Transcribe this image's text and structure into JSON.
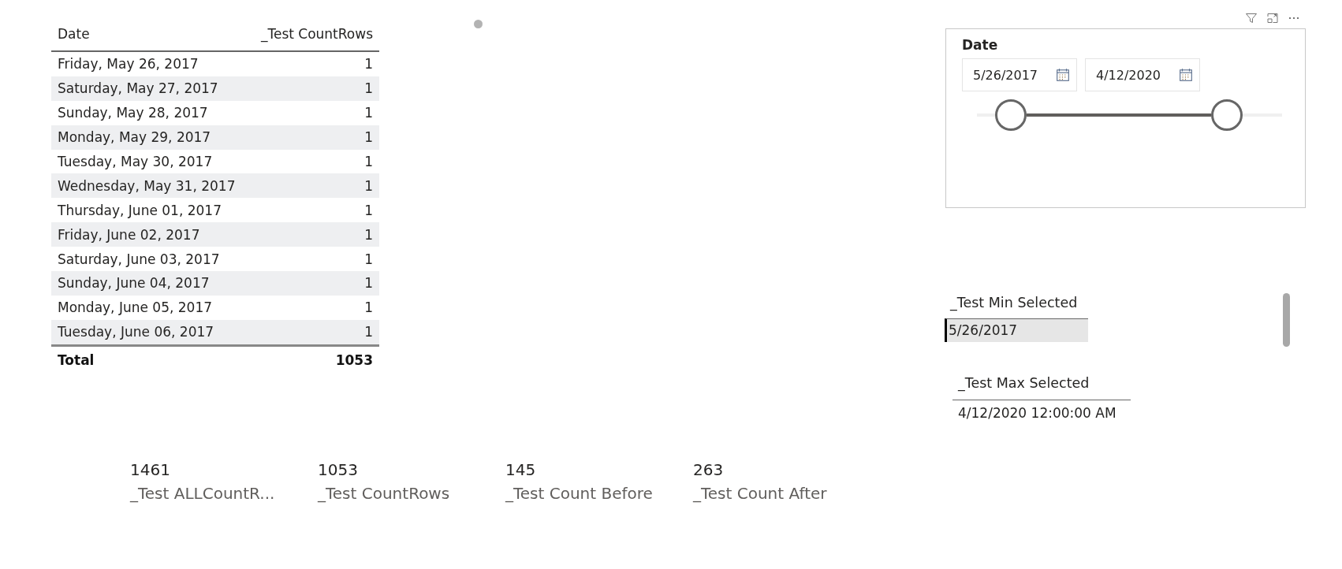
{
  "table": {
    "columns": [
      "Date",
      "_Test CountRows"
    ],
    "rows": [
      {
        "date": "Friday, May 26, 2017",
        "count": "1"
      },
      {
        "date": "Saturday, May 27, 2017",
        "count": "1"
      },
      {
        "date": "Sunday, May 28, 2017",
        "count": "1"
      },
      {
        "date": "Monday, May 29, 2017",
        "count": "1"
      },
      {
        "date": "Tuesday, May 30, 2017",
        "count": "1"
      },
      {
        "date": "Wednesday, May 31, 2017",
        "count": "1"
      },
      {
        "date": "Thursday, June 01, 2017",
        "count": "1"
      },
      {
        "date": "Friday, June 02, 2017",
        "count": "1"
      },
      {
        "date": "Saturday, June 03, 2017",
        "count": "1"
      },
      {
        "date": "Sunday, June 04, 2017",
        "count": "1"
      },
      {
        "date": "Monday, June 05, 2017",
        "count": "1"
      },
      {
        "date": "Tuesday, June 06, 2017",
        "count": "1"
      }
    ],
    "total": {
      "label": "Total",
      "value": "1053"
    }
  },
  "slicer": {
    "title": "Date",
    "start_input": {
      "value": "5/26/2017"
    },
    "end_input": {
      "value": "4/12/2020"
    },
    "handles": [
      {
        "level": 0.11
      },
      {
        "level": 0.82
      }
    ]
  },
  "min_selected": {
    "label": "_Test Min Selected",
    "value": "5/26/2017"
  },
  "max_selected": {
    "label": "_Test Max Selected",
    "value": "4/12/2020 12:00:00 AM"
  },
  "cards": [
    {
      "value": "1461",
      "label": "_Test ALLCountR..."
    },
    {
      "value": "1053",
      "label": "_Test CountRows"
    },
    {
      "value": "145",
      "label": "_Test Count Before"
    },
    {
      "value": "263",
      "label": "_Test Count After"
    }
  ]
}
